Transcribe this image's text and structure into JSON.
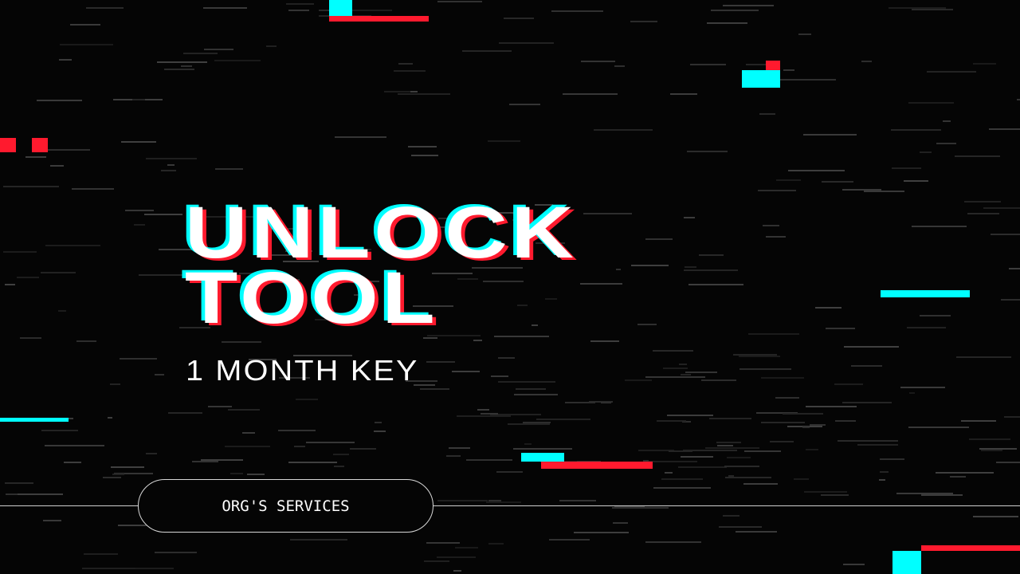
{
  "title": {
    "line1": "UNLOCK",
    "line2": "TOOL"
  },
  "subtitle": "1 MONTH KEY",
  "button": {
    "label": "ORG'S SERVICES"
  },
  "colors": {
    "cyan": "#00ffff",
    "red": "#ff1a2e",
    "background": "#050505"
  }
}
